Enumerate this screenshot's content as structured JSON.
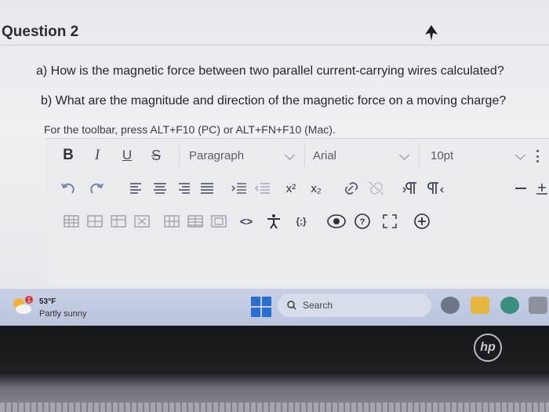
{
  "question": {
    "title": "Question 2",
    "part_a": "a) How is the magnetic force between two parallel current-carrying wires calculated?",
    "part_b": "b) What are the magnitude and direction of the magnetic force on a moving charge?"
  },
  "editor": {
    "toolbar_hint": "For the toolbar, press ALT+F10 (PC) or ALT+FN+F10 (Mac).",
    "bold_label": "B",
    "italic_label": "I",
    "underline_label": "U",
    "strike_label": "S",
    "paragraph_select": "Paragraph",
    "font_select": "Arial",
    "size_select": "10pt",
    "row2_icons": [
      "undo-icon",
      "redo-icon",
      "align-left-icon",
      "align-center-icon",
      "align-right-icon",
      "justify-icon",
      "indent-icon",
      "outdent-icon",
      "superscript-icon",
      "subscript-icon",
      "link-icon",
      "unlink-icon",
      "ltr-icon",
      "rtl-icon",
      "horizontal-rule-icon"
    ],
    "row3_icons": [
      "table-icon",
      "table-insert-icon",
      "table-cell-icon",
      "table-delete-icon",
      "table-row-icon",
      "table-col-icon",
      "table-merge-icon",
      "code-icon",
      "accessibility-icon",
      "math-icon",
      "preview-icon",
      "help-icon",
      "fullscreen-icon",
      "add-content-icon"
    ],
    "superscript_label": "x²",
    "subscript_label": "x₂",
    "code_label": "<>",
    "math_label": "{;}"
  },
  "taskbar": {
    "weather_temp": "53°F",
    "weather_desc": "Partly sunny",
    "search_label": "Search",
    "badge": "1"
  },
  "device": {
    "logo": "hp"
  },
  "colors": {
    "accent": "#2a6fd0",
    "taskbar": "#c3cce3",
    "editor_bg": "#e9ebef"
  }
}
